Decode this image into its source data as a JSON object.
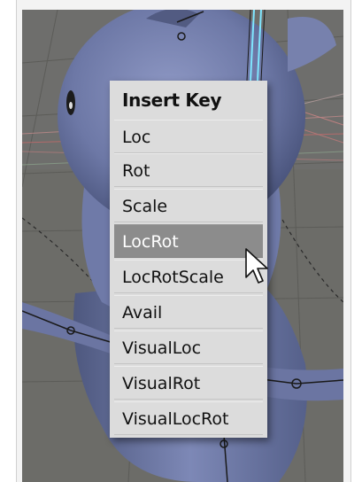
{
  "menu": {
    "title": "Insert Key",
    "items": [
      {
        "label": "Loc"
      },
      {
        "label": "Rot"
      },
      {
        "label": "Scale"
      },
      {
        "label": "LocRot",
        "highlighted": true
      },
      {
        "label": "LocRotScale"
      },
      {
        "label": "Avail"
      },
      {
        "label": "VisualLoc"
      },
      {
        "label": "VisualRot"
      },
      {
        "label": "VisualLocRot"
      }
    ]
  },
  "colors": {
    "viewport_bg": "#6e6e6a",
    "model": "#6f7aa8",
    "menu_bg": "#dcdcdc",
    "highlight": "#8c8c8c",
    "bone_highlight": "#7fe6ff"
  },
  "icons": {
    "cursor": "arrow-cursor-icon"
  }
}
